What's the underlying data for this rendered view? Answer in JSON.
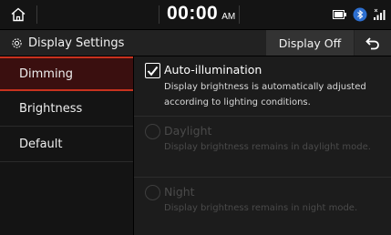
{
  "status_bar": {
    "home_icon": "home-icon",
    "time": "00:00",
    "ampm": "AM",
    "icons": [
      "battery-icon",
      "bluetooth-icon",
      "signal-icon"
    ]
  },
  "title_bar": {
    "settings_icon": "gear-icon",
    "title": "Display Settings",
    "display_off_label": "Display Off",
    "back_icon": "back-arrow-icon"
  },
  "sidebar": {
    "items": [
      {
        "label": "Dimming",
        "active": true
      },
      {
        "label": "Brightness",
        "active": false
      },
      {
        "label": "Default",
        "active": false
      }
    ]
  },
  "options": [
    {
      "type": "checkbox",
      "checked": true,
      "enabled": true,
      "title": "Auto-illumination",
      "description": "Display brightness is automatically adjusted according to lighting conditions."
    },
    {
      "type": "radio",
      "checked": false,
      "enabled": false,
      "title": "Daylight",
      "description": "Display brightness remains in daylight mode."
    },
    {
      "type": "radio",
      "checked": false,
      "enabled": false,
      "title": "Night",
      "description": "Display brightness remains in night mode."
    }
  ],
  "colors": {
    "accent": "#c8321e",
    "background": "#000000",
    "panel": "#1c1c1c",
    "disabled_text": "#4a4a4a"
  }
}
